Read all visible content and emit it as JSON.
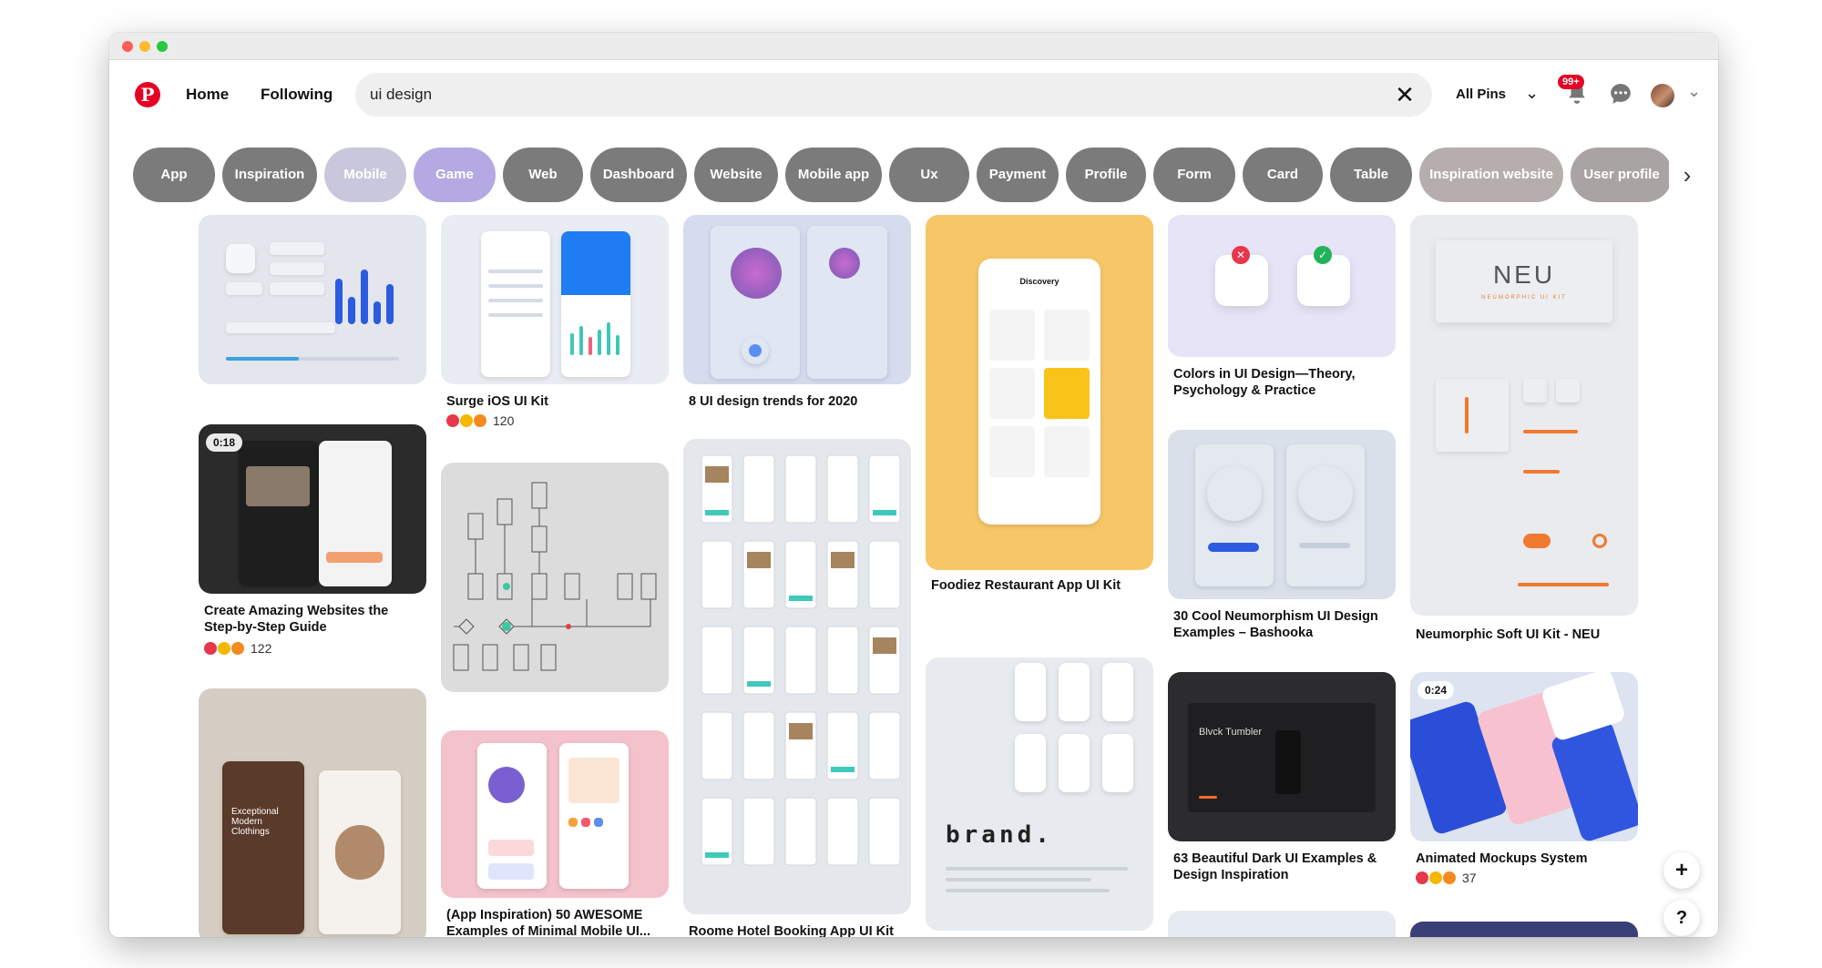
{
  "header": {
    "logo": "P",
    "nav": {
      "home": "Home",
      "following": "Following"
    },
    "search": {
      "value": "ui design",
      "clear_icon": "close-icon"
    },
    "filter": {
      "label": "All Pins"
    },
    "notifications_badge": "99+"
  },
  "chips": [
    "App",
    "Inspiration",
    "Mobile",
    "Game",
    "Web",
    "Dashboard",
    "Website",
    "Mobile app",
    "Ux",
    "Payment",
    "Profile",
    "Form",
    "Card",
    "Table",
    "Inspiration website",
    "User profile"
  ],
  "chip_colors": [
    "#7b7b7b",
    "#7b7b7b",
    "#c9c7dc",
    "#b4a9e3",
    "#7b7b7b",
    "#7b7b7b",
    "#7b7b7b",
    "#7b7b7b",
    "#7b7b7b",
    "#7b7b7b",
    "#7b7b7b",
    "#7b7b7b",
    "#7b7b7b",
    "#7b7b7b",
    "#b6adad",
    "#aaa3a3"
  ],
  "pins": {
    "p1": {
      "title": ""
    },
    "p2": {
      "title": "Surge iOS UI Kit",
      "reactions": "120"
    },
    "p3": {
      "title": "8 UI design trends for 2020"
    },
    "p4": {
      "title": "Foodiez Restaurant App UI Kit",
      "img_header": "Discovery"
    },
    "p5": {
      "title": "Colors in UI Design—Theory, Psychology & Practice"
    },
    "p6": {
      "title": "Neumorphic Soft UI Kit - NEU",
      "img_text": "NEU",
      "img_sub": "NEUMORPHIC UI KIT"
    },
    "p7": {
      "title": "Create Amazing Websites the Step-by-Step Guide",
      "reactions": "122",
      "video": "0:18"
    },
    "p8": {
      "title": "30 Cool Neumorphism UI Design Examples – Bashooka"
    },
    "p9": {
      "title": "(App Inspiration) 50 AWESOME Examples of Minimal Mobile UI..."
    },
    "p10": {
      "title": "Roome Hotel Booking App UI Kit"
    },
    "p11": {
      "title": "63 Beautiful Dark UI Examples & Design Inspiration",
      "img_text": "Blvck Tumbler"
    },
    "p12": {
      "title": "Animated Mockups System",
      "reactions": "37",
      "video": "0:24"
    },
    "p13": {
      "img_text": "brand."
    },
    "p14": {
      "img_text": "Exceptional Modern Clothings"
    }
  },
  "fab": {
    "add": "+",
    "help": "?"
  },
  "colors": {
    "brand": "#e60023",
    "chip": "#7b7b7b"
  }
}
